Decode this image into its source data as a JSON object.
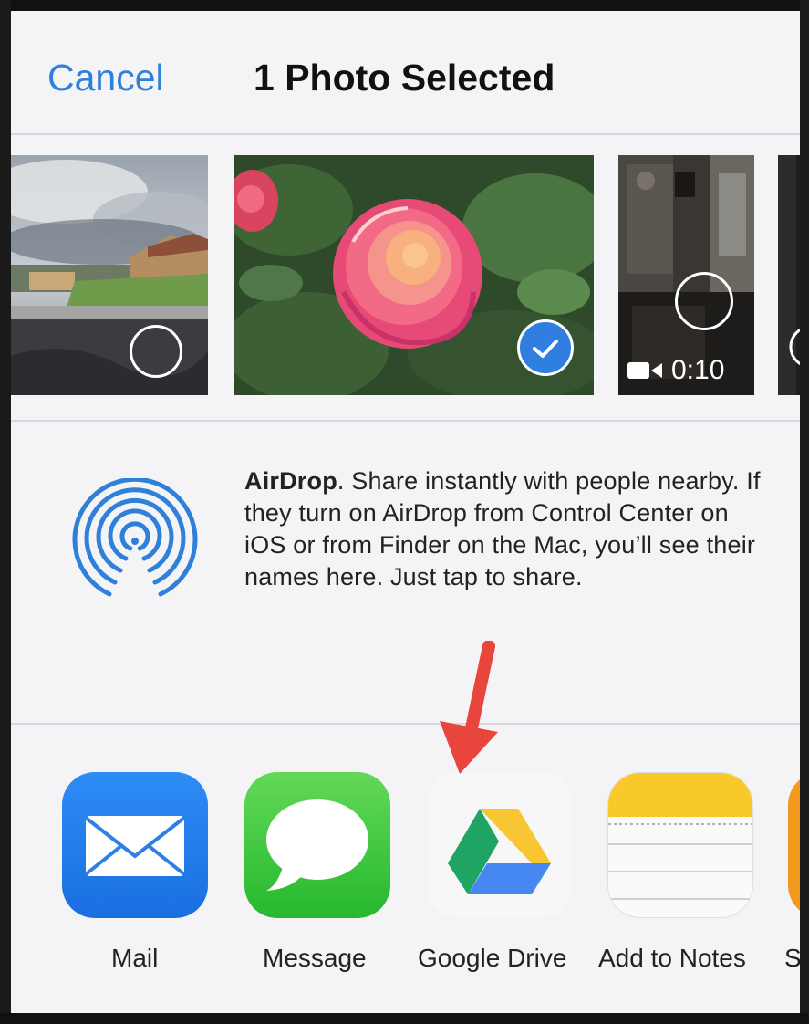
{
  "header": {
    "cancel_label": "Cancel",
    "title": "1 Photo Selected"
  },
  "photos": [
    {
      "name": "street-scene",
      "selected": false
    },
    {
      "name": "rose",
      "selected": true
    },
    {
      "name": "video",
      "selected": false,
      "duration": "0:10"
    },
    {
      "name": "partial",
      "selected": false
    }
  ],
  "airdrop": {
    "title": "AirDrop",
    "description": ". Share instantly with people nearby. If they turn on AirDrop from Control Center on iOS or from Finder on the Mac, you’ll see their names here. Just tap to share.",
    "accent_color": "#2f80d8"
  },
  "apps": [
    {
      "label": "Mail",
      "icon": "mail-icon"
    },
    {
      "label": "Message",
      "icon": "message-icon"
    },
    {
      "label": "Google Drive",
      "icon": "google-drive-icon"
    },
    {
      "label": "Add to Notes",
      "icon": "notes-icon"
    },
    {
      "label": "S",
      "icon": "partial-app-icon"
    }
  ],
  "colors": {
    "ios_blue": "#2f80d8",
    "sheet_bg": "#f4f3f6",
    "arrow_red": "#e8453c"
  }
}
